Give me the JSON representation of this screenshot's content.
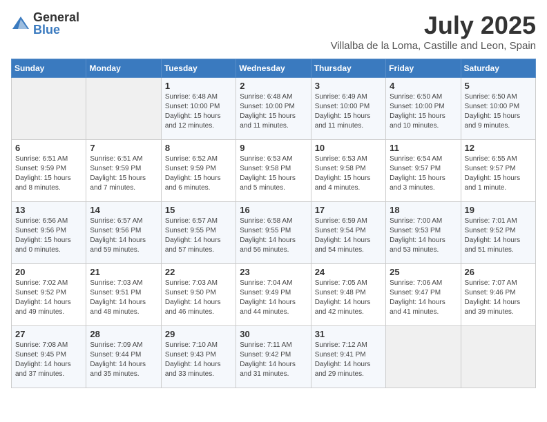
{
  "logo": {
    "general": "General",
    "blue": "Blue"
  },
  "title": {
    "month": "July 2025",
    "location": "Villalba de la Loma, Castille and Leon, Spain"
  },
  "weekdays": [
    "Sunday",
    "Monday",
    "Tuesday",
    "Wednesday",
    "Thursday",
    "Friday",
    "Saturday"
  ],
  "weeks": [
    [
      {
        "day": "",
        "info": ""
      },
      {
        "day": "",
        "info": ""
      },
      {
        "day": "1",
        "info": "Sunrise: 6:48 AM\nSunset: 10:00 PM\nDaylight: 15 hours and 12 minutes."
      },
      {
        "day": "2",
        "info": "Sunrise: 6:48 AM\nSunset: 10:00 PM\nDaylight: 15 hours and 11 minutes."
      },
      {
        "day": "3",
        "info": "Sunrise: 6:49 AM\nSunset: 10:00 PM\nDaylight: 15 hours and 11 minutes."
      },
      {
        "day": "4",
        "info": "Sunrise: 6:50 AM\nSunset: 10:00 PM\nDaylight: 15 hours and 10 minutes."
      },
      {
        "day": "5",
        "info": "Sunrise: 6:50 AM\nSunset: 10:00 PM\nDaylight: 15 hours and 9 minutes."
      }
    ],
    [
      {
        "day": "6",
        "info": "Sunrise: 6:51 AM\nSunset: 9:59 PM\nDaylight: 15 hours and 8 minutes."
      },
      {
        "day": "7",
        "info": "Sunrise: 6:51 AM\nSunset: 9:59 PM\nDaylight: 15 hours and 7 minutes."
      },
      {
        "day": "8",
        "info": "Sunrise: 6:52 AM\nSunset: 9:59 PM\nDaylight: 15 hours and 6 minutes."
      },
      {
        "day": "9",
        "info": "Sunrise: 6:53 AM\nSunset: 9:58 PM\nDaylight: 15 hours and 5 minutes."
      },
      {
        "day": "10",
        "info": "Sunrise: 6:53 AM\nSunset: 9:58 PM\nDaylight: 15 hours and 4 minutes."
      },
      {
        "day": "11",
        "info": "Sunrise: 6:54 AM\nSunset: 9:57 PM\nDaylight: 15 hours and 3 minutes."
      },
      {
        "day": "12",
        "info": "Sunrise: 6:55 AM\nSunset: 9:57 PM\nDaylight: 15 hours and 1 minute."
      }
    ],
    [
      {
        "day": "13",
        "info": "Sunrise: 6:56 AM\nSunset: 9:56 PM\nDaylight: 15 hours and 0 minutes."
      },
      {
        "day": "14",
        "info": "Sunrise: 6:57 AM\nSunset: 9:56 PM\nDaylight: 14 hours and 59 minutes."
      },
      {
        "day": "15",
        "info": "Sunrise: 6:57 AM\nSunset: 9:55 PM\nDaylight: 14 hours and 57 minutes."
      },
      {
        "day": "16",
        "info": "Sunrise: 6:58 AM\nSunset: 9:55 PM\nDaylight: 14 hours and 56 minutes."
      },
      {
        "day": "17",
        "info": "Sunrise: 6:59 AM\nSunset: 9:54 PM\nDaylight: 14 hours and 54 minutes."
      },
      {
        "day": "18",
        "info": "Sunrise: 7:00 AM\nSunset: 9:53 PM\nDaylight: 14 hours and 53 minutes."
      },
      {
        "day": "19",
        "info": "Sunrise: 7:01 AM\nSunset: 9:52 PM\nDaylight: 14 hours and 51 minutes."
      }
    ],
    [
      {
        "day": "20",
        "info": "Sunrise: 7:02 AM\nSunset: 9:52 PM\nDaylight: 14 hours and 49 minutes."
      },
      {
        "day": "21",
        "info": "Sunrise: 7:03 AM\nSunset: 9:51 PM\nDaylight: 14 hours and 48 minutes."
      },
      {
        "day": "22",
        "info": "Sunrise: 7:03 AM\nSunset: 9:50 PM\nDaylight: 14 hours and 46 minutes."
      },
      {
        "day": "23",
        "info": "Sunrise: 7:04 AM\nSunset: 9:49 PM\nDaylight: 14 hours and 44 minutes."
      },
      {
        "day": "24",
        "info": "Sunrise: 7:05 AM\nSunset: 9:48 PM\nDaylight: 14 hours and 42 minutes."
      },
      {
        "day": "25",
        "info": "Sunrise: 7:06 AM\nSunset: 9:47 PM\nDaylight: 14 hours and 41 minutes."
      },
      {
        "day": "26",
        "info": "Sunrise: 7:07 AM\nSunset: 9:46 PM\nDaylight: 14 hours and 39 minutes."
      }
    ],
    [
      {
        "day": "27",
        "info": "Sunrise: 7:08 AM\nSunset: 9:45 PM\nDaylight: 14 hours and 37 minutes."
      },
      {
        "day": "28",
        "info": "Sunrise: 7:09 AM\nSunset: 9:44 PM\nDaylight: 14 hours and 35 minutes."
      },
      {
        "day": "29",
        "info": "Sunrise: 7:10 AM\nSunset: 9:43 PM\nDaylight: 14 hours and 33 minutes."
      },
      {
        "day": "30",
        "info": "Sunrise: 7:11 AM\nSunset: 9:42 PM\nDaylight: 14 hours and 31 minutes."
      },
      {
        "day": "31",
        "info": "Sunrise: 7:12 AM\nSunset: 9:41 PM\nDaylight: 14 hours and 29 minutes."
      },
      {
        "day": "",
        "info": ""
      },
      {
        "day": "",
        "info": ""
      }
    ]
  ]
}
